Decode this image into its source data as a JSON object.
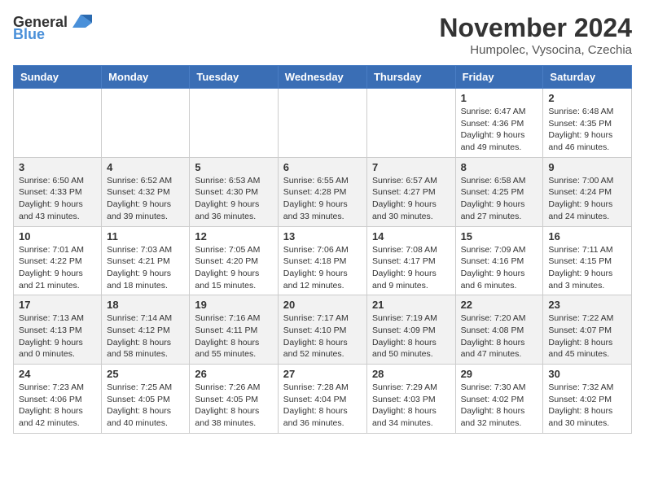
{
  "logo": {
    "general": "General",
    "blue": "Blue"
  },
  "title": "November 2024",
  "subtitle": "Humpolec, Vysocina, Czechia",
  "headers": [
    "Sunday",
    "Monday",
    "Tuesday",
    "Wednesday",
    "Thursday",
    "Friday",
    "Saturday"
  ],
  "weeks": [
    [
      {
        "day": "",
        "info": ""
      },
      {
        "day": "",
        "info": ""
      },
      {
        "day": "",
        "info": ""
      },
      {
        "day": "",
        "info": ""
      },
      {
        "day": "",
        "info": ""
      },
      {
        "day": "1",
        "info": "Sunrise: 6:47 AM\nSunset: 4:36 PM\nDaylight: 9 hours and 49 minutes."
      },
      {
        "day": "2",
        "info": "Sunrise: 6:48 AM\nSunset: 4:35 PM\nDaylight: 9 hours and 46 minutes."
      }
    ],
    [
      {
        "day": "3",
        "info": "Sunrise: 6:50 AM\nSunset: 4:33 PM\nDaylight: 9 hours and 43 minutes."
      },
      {
        "day": "4",
        "info": "Sunrise: 6:52 AM\nSunset: 4:32 PM\nDaylight: 9 hours and 39 minutes."
      },
      {
        "day": "5",
        "info": "Sunrise: 6:53 AM\nSunset: 4:30 PM\nDaylight: 9 hours and 36 minutes."
      },
      {
        "day": "6",
        "info": "Sunrise: 6:55 AM\nSunset: 4:28 PM\nDaylight: 9 hours and 33 minutes."
      },
      {
        "day": "7",
        "info": "Sunrise: 6:57 AM\nSunset: 4:27 PM\nDaylight: 9 hours and 30 minutes."
      },
      {
        "day": "8",
        "info": "Sunrise: 6:58 AM\nSunset: 4:25 PM\nDaylight: 9 hours and 27 minutes."
      },
      {
        "day": "9",
        "info": "Sunrise: 7:00 AM\nSunset: 4:24 PM\nDaylight: 9 hours and 24 minutes."
      }
    ],
    [
      {
        "day": "10",
        "info": "Sunrise: 7:01 AM\nSunset: 4:22 PM\nDaylight: 9 hours and 21 minutes."
      },
      {
        "day": "11",
        "info": "Sunrise: 7:03 AM\nSunset: 4:21 PM\nDaylight: 9 hours and 18 minutes."
      },
      {
        "day": "12",
        "info": "Sunrise: 7:05 AM\nSunset: 4:20 PM\nDaylight: 9 hours and 15 minutes."
      },
      {
        "day": "13",
        "info": "Sunrise: 7:06 AM\nSunset: 4:18 PM\nDaylight: 9 hours and 12 minutes."
      },
      {
        "day": "14",
        "info": "Sunrise: 7:08 AM\nSunset: 4:17 PM\nDaylight: 9 hours and 9 minutes."
      },
      {
        "day": "15",
        "info": "Sunrise: 7:09 AM\nSunset: 4:16 PM\nDaylight: 9 hours and 6 minutes."
      },
      {
        "day": "16",
        "info": "Sunrise: 7:11 AM\nSunset: 4:15 PM\nDaylight: 9 hours and 3 minutes."
      }
    ],
    [
      {
        "day": "17",
        "info": "Sunrise: 7:13 AM\nSunset: 4:13 PM\nDaylight: 9 hours and 0 minutes."
      },
      {
        "day": "18",
        "info": "Sunrise: 7:14 AM\nSunset: 4:12 PM\nDaylight: 8 hours and 58 minutes."
      },
      {
        "day": "19",
        "info": "Sunrise: 7:16 AM\nSunset: 4:11 PM\nDaylight: 8 hours and 55 minutes."
      },
      {
        "day": "20",
        "info": "Sunrise: 7:17 AM\nSunset: 4:10 PM\nDaylight: 8 hours and 52 minutes."
      },
      {
        "day": "21",
        "info": "Sunrise: 7:19 AM\nSunset: 4:09 PM\nDaylight: 8 hours and 50 minutes."
      },
      {
        "day": "22",
        "info": "Sunrise: 7:20 AM\nSunset: 4:08 PM\nDaylight: 8 hours and 47 minutes."
      },
      {
        "day": "23",
        "info": "Sunrise: 7:22 AM\nSunset: 4:07 PM\nDaylight: 8 hours and 45 minutes."
      }
    ],
    [
      {
        "day": "24",
        "info": "Sunrise: 7:23 AM\nSunset: 4:06 PM\nDaylight: 8 hours and 42 minutes."
      },
      {
        "day": "25",
        "info": "Sunrise: 7:25 AM\nSunset: 4:05 PM\nDaylight: 8 hours and 40 minutes."
      },
      {
        "day": "26",
        "info": "Sunrise: 7:26 AM\nSunset: 4:05 PM\nDaylight: 8 hours and 38 minutes."
      },
      {
        "day": "27",
        "info": "Sunrise: 7:28 AM\nSunset: 4:04 PM\nDaylight: 8 hours and 36 minutes."
      },
      {
        "day": "28",
        "info": "Sunrise: 7:29 AM\nSunset: 4:03 PM\nDaylight: 8 hours and 34 minutes."
      },
      {
        "day": "29",
        "info": "Sunrise: 7:30 AM\nSunset: 4:02 PM\nDaylight: 8 hours and 32 minutes."
      },
      {
        "day": "30",
        "info": "Sunrise: 7:32 AM\nSunset: 4:02 PM\nDaylight: 8 hours and 30 minutes."
      }
    ]
  ]
}
